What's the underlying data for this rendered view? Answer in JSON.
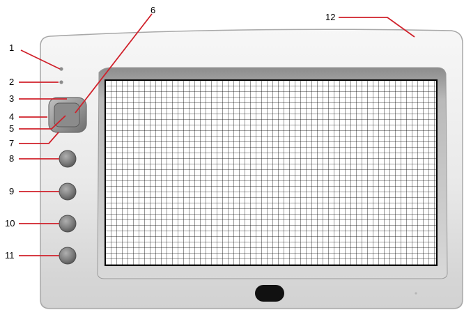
{
  "callouts": {
    "c1": "1",
    "c2": "2",
    "c3": "3",
    "c4": "4",
    "c5": "5",
    "c6": "6",
    "c7": "7",
    "c8": "8",
    "c9": "9",
    "c10": "10",
    "c11": "11",
    "c12": "12"
  },
  "colors": {
    "callout_line": "#d0202a",
    "bezel_light": "#f2f2f2",
    "bezel_dark": "#9e9e9e",
    "screen_grid": "#000000",
    "button_fill": "#8a8a8a"
  }
}
